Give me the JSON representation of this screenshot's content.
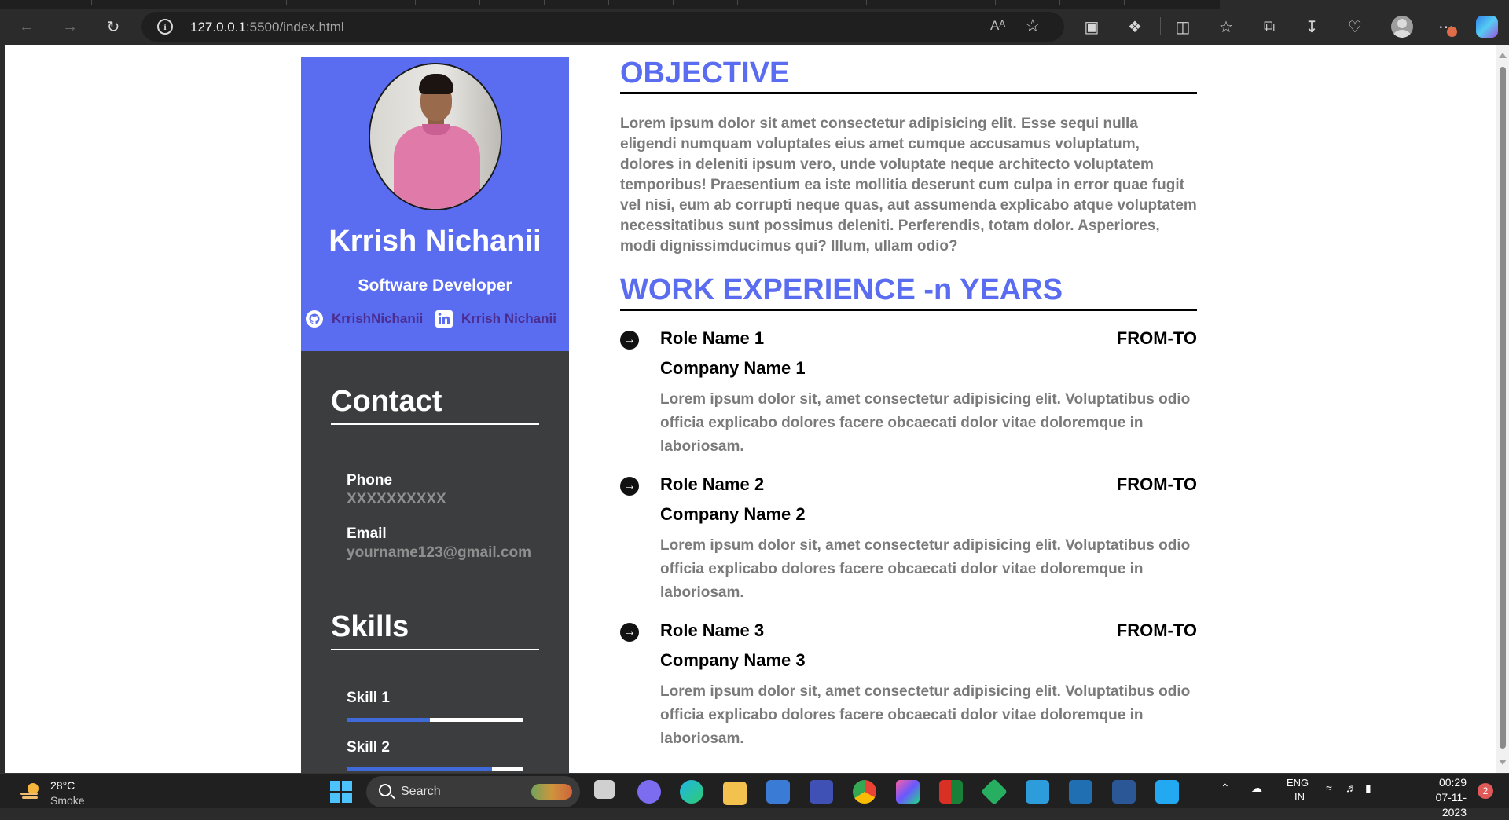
{
  "browser": {
    "url_host": "127.0.0.1",
    "url_rest": ":5500/index.html",
    "read_aloud": "Aᴬ"
  },
  "profile": {
    "name": "Krrish Nichanii",
    "title": "Software Developer",
    "github_label": "KrrishNichanii",
    "linkedin_label": "Krrish Nichanii",
    "accent_color": "#5a6cf0",
    "link_color": "#4b2c8f"
  },
  "contact": {
    "heading": "Contact",
    "phone_label": "Phone",
    "phone_value": "XXXXXXXXXX",
    "email_label": "Email",
    "email_value": "yourname123@gmail.com"
  },
  "skills": {
    "heading": "Skills",
    "items": [
      {
        "label": "Skill 1",
        "level": 0.47
      },
      {
        "label": "Skill 2",
        "level": 0.82
      }
    ]
  },
  "objective": {
    "heading": "OBJECTIVE",
    "text": "Lorem ipsum dolor sit amet consectetur adipisicing elit. Esse sequi nulla eligendi numquam voluptates eius amet cumque accusamus voluptatum, dolores in deleniti ipsum vero, unde voluptate neque architecto voluptatem temporibus! Praesentium ea iste mollitia deserunt cum culpa in error quae fugit vel nisi, eum ab corrupti neque quas, aut assumenda explicabo atque voluptatem necessitatibus sunt possimus deleniti. Perferendis, totam dolor. Asperiores, modi dignissimducimus qui? Illum, ullam odio?"
  },
  "experience": {
    "heading": "WORK EXPERIENCE -n YEARS",
    "jobs": [
      {
        "role": "Role Name 1",
        "dates": "FROM-TO",
        "company": "Company Name 1",
        "description": "Lorem ipsum dolor sit, amet consectetur adipisicing elit. Voluptatibus odio officia explicabo dolores facere obcaecati dolor vitae doloremque in laboriosam."
      },
      {
        "role": "Role Name 2",
        "dates": "FROM-TO",
        "company": "Company Name 2",
        "description": "Lorem ipsum dolor sit, amet consectetur adipisicing elit. Voluptatibus odio officia explicabo dolores facere obcaecati dolor vitae doloremque in laboriosam."
      },
      {
        "role": "Role Name 3",
        "dates": "FROM-TO",
        "company": "Company Name 3",
        "description": "Lorem ipsum dolor sit, amet consectetur adipisicing elit. Voluptatibus odio officia explicabo dolores facere obcaecati dolor vitae doloremque in laboriosam."
      }
    ]
  },
  "taskbar": {
    "weather_temp": "28°C",
    "weather_desc": "Smoke",
    "search_placeholder": "Search",
    "language": "ENG",
    "language_sub": "IN",
    "time": "00:29",
    "date": "07-11-2023",
    "notification_count": "2"
  }
}
